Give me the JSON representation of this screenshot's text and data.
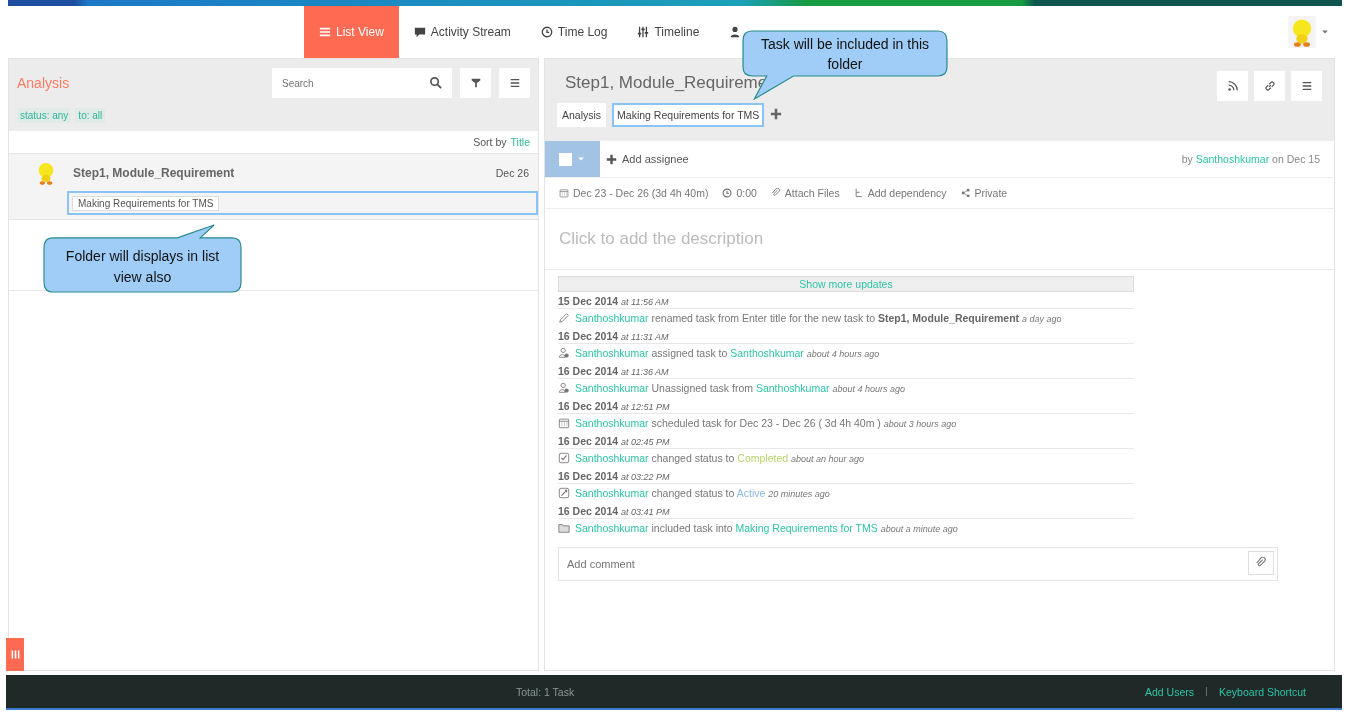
{
  "nav": {
    "tabs": [
      {
        "label": "List View",
        "selected": true
      },
      {
        "label": "Activity Stream",
        "selected": false
      },
      {
        "label": "Time Log",
        "selected": false
      },
      {
        "label": "Timeline",
        "selected": false
      }
    ]
  },
  "list_panel": {
    "folder": "Analysis",
    "search": {
      "placeholder": "Search"
    },
    "filters": [
      "status: any",
      "to: all"
    ],
    "sort_label": "Sort by",
    "sort_value": "Title",
    "tasks": [
      {
        "title": "Step1, Module_Requirement",
        "date": "Dec 26",
        "folder_tag": "Making Requirements for TMS",
        "highlighted": true
      }
    ]
  },
  "task": {
    "title": "Step1, Module_Requireme",
    "folders": [
      {
        "label": "Analysis",
        "highlighted": false
      },
      {
        "label": "Making Requirements for TMS",
        "highlighted": true
      }
    ],
    "checked": false,
    "assignee_placeholder": "Add assignee",
    "created_by": "by",
    "creator": "Santhoshkumar",
    "created_on": "on Dec 15",
    "details": [
      "Dec 23 - Dec 26 (3d 4h 40m)",
      "0:00",
      "Attach Files",
      "Add dependency",
      "Private"
    ],
    "description_placeholder": "Click to add the description",
    "show_more": "Show more updates",
    "updates": [
      {
        "date": "15 Dec 2014",
        "time": "at 11:56 AM",
        "kind": "rename",
        "parts": [
          {
            "kind": "user",
            "text": "Santhoshkumar"
          },
          {
            "kind": "plain",
            "text": "renamed task from Enter title for the new task to"
          },
          {
            "kind": "bold",
            "text": "Step1, Module_Requirement"
          }
        ],
        "ago": "a day ago"
      },
      {
        "date": "16 Dec 2014",
        "time": "at 11:31 AM",
        "kind": "assign",
        "parts": [
          {
            "kind": "user",
            "text": "Santhoshkumar"
          },
          {
            "kind": "plain",
            "text": "assigned task to"
          },
          {
            "kind": "user",
            "text": "Santhoshkumar"
          }
        ],
        "ago": "about 4 hours ago"
      },
      {
        "date": "16 Dec 2014",
        "time": "at 11:36 AM",
        "kind": "assign",
        "parts": [
          {
            "kind": "user",
            "text": "Santhoshkumar"
          },
          {
            "kind": "plain",
            "text": "Unassigned task from"
          },
          {
            "kind": "user",
            "text": "Santhoshkumar"
          }
        ],
        "ago": "about 4 hours ago"
      },
      {
        "date": "16 Dec 2014",
        "time": "at 12:51 PM",
        "kind": "schedule",
        "parts": [
          {
            "kind": "user",
            "text": "Santhoshkumar"
          },
          {
            "kind": "plain",
            "text": "scheduled task for Dec 23 - Dec 26 ( 3d 4h 40m )"
          }
        ],
        "ago": "about 3 hours ago"
      },
      {
        "date": "16 Dec 2014",
        "time": "at 02:45 PM",
        "kind": "complete",
        "parts": [
          {
            "kind": "user",
            "text": "Santhoshkumar"
          },
          {
            "kind": "plain",
            "text": "changed status to"
          },
          {
            "kind": "completed",
            "text": "Completed"
          }
        ],
        "ago": "about an hour ago"
      },
      {
        "date": "16 Dec 2014",
        "time": "at 03:22 PM",
        "kind": "status",
        "parts": [
          {
            "kind": "user",
            "text": "Santhoshkumar"
          },
          {
            "kind": "plain",
            "text": "changed status to"
          },
          {
            "kind": "active",
            "text": "Active"
          }
        ],
        "ago": "20 minutes ago"
      },
      {
        "date": "16 Dec 2014",
        "time": "at 03:41 PM",
        "kind": "folder",
        "parts": [
          {
            "kind": "user",
            "text": "Santhoshkumar"
          },
          {
            "kind": "plain",
            "text": "included task into"
          },
          {
            "kind": "link",
            "text": "Making Requirements for TMS"
          }
        ],
        "ago": "about a minute ago"
      }
    ],
    "comment": {
      "placeholder": "Add comment"
    }
  },
  "callouts": [
    "Folder will displays in list view also",
    "Task will be included in this folder"
  ],
  "footer": {
    "total": "Total: 1 Task",
    "links": [
      "Add Users",
      "Keyboard Shortcut"
    ]
  }
}
